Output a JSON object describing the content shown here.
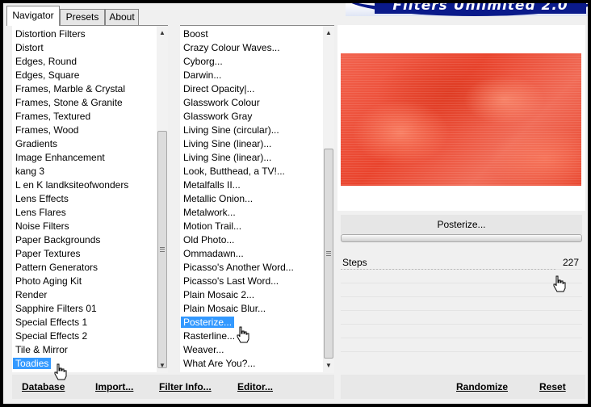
{
  "window": {
    "banner_title": "Filters Unlimited 2.0",
    "colors": {
      "banner_blue": "#0a1a8a",
      "selection": "#3399ff",
      "preview_red": "#e9432c"
    }
  },
  "tabs": [
    {
      "label": "Navigator",
      "active": true
    },
    {
      "label": "Presets",
      "active": false
    },
    {
      "label": "About",
      "active": false
    }
  ],
  "categories": {
    "items": [
      "Distortion Filters",
      "Distort",
      "Edges, Round",
      "Edges, Square",
      "Frames, Marble & Crystal",
      "Frames, Stone & Granite",
      "Frames, Textured",
      "Frames, Wood",
      "Gradients",
      "Image Enhancement",
      "kang 3",
      "L en K landksiteofwonders",
      "Lens Effects",
      "Lens Flares",
      "Noise Filters",
      "Paper Backgrounds",
      "Paper Textures",
      "Pattern Generators",
      "Photo Aging Kit",
      "Render",
      "Sapphire Filters 01",
      "Special Effects 1",
      "Special Effects 2",
      "Tile & Mirror",
      "Toadies"
    ],
    "selected": "Toadies",
    "scroll_up_icon": "triangle-up",
    "scroll_down_icon": "triangle-down"
  },
  "filters": {
    "items": [
      "Boost",
      "Crazy Colour Waves...",
      "Cyborg...",
      "Darwin...",
      "Direct Opacity|...",
      "Glasswork Colour",
      "Glasswork Gray",
      "Living Sine (circular)...",
      "Living Sine (linear)...",
      "Living Sine (linear)...",
      "Look, Butthead, a TV!...",
      "Metalfalls II...",
      "Metallic Onion...",
      "Metalwork...",
      "Motion Trail...",
      "Old Photo...",
      "Ommadawn...",
      "Picasso's Another Word...",
      "Picasso's Last Word...",
      "Plain Mosaic 2...",
      "Plain Mosaic Blur...",
      "Posterize...",
      "Rasterline...",
      "Weaver...",
      "What Are You?..."
    ],
    "selected": "Posterize..."
  },
  "filter_panel": {
    "name": "Posterize...",
    "params": [
      {
        "label": "Steps",
        "value": "227",
        "fraction": 0.89
      }
    ],
    "empty_rows": 7
  },
  "buttons": {
    "database": "Database",
    "import": "Import...",
    "filter_info": "Filter Info...",
    "editor": "Editor...",
    "randomize": "Randomize",
    "reset": "Reset"
  }
}
